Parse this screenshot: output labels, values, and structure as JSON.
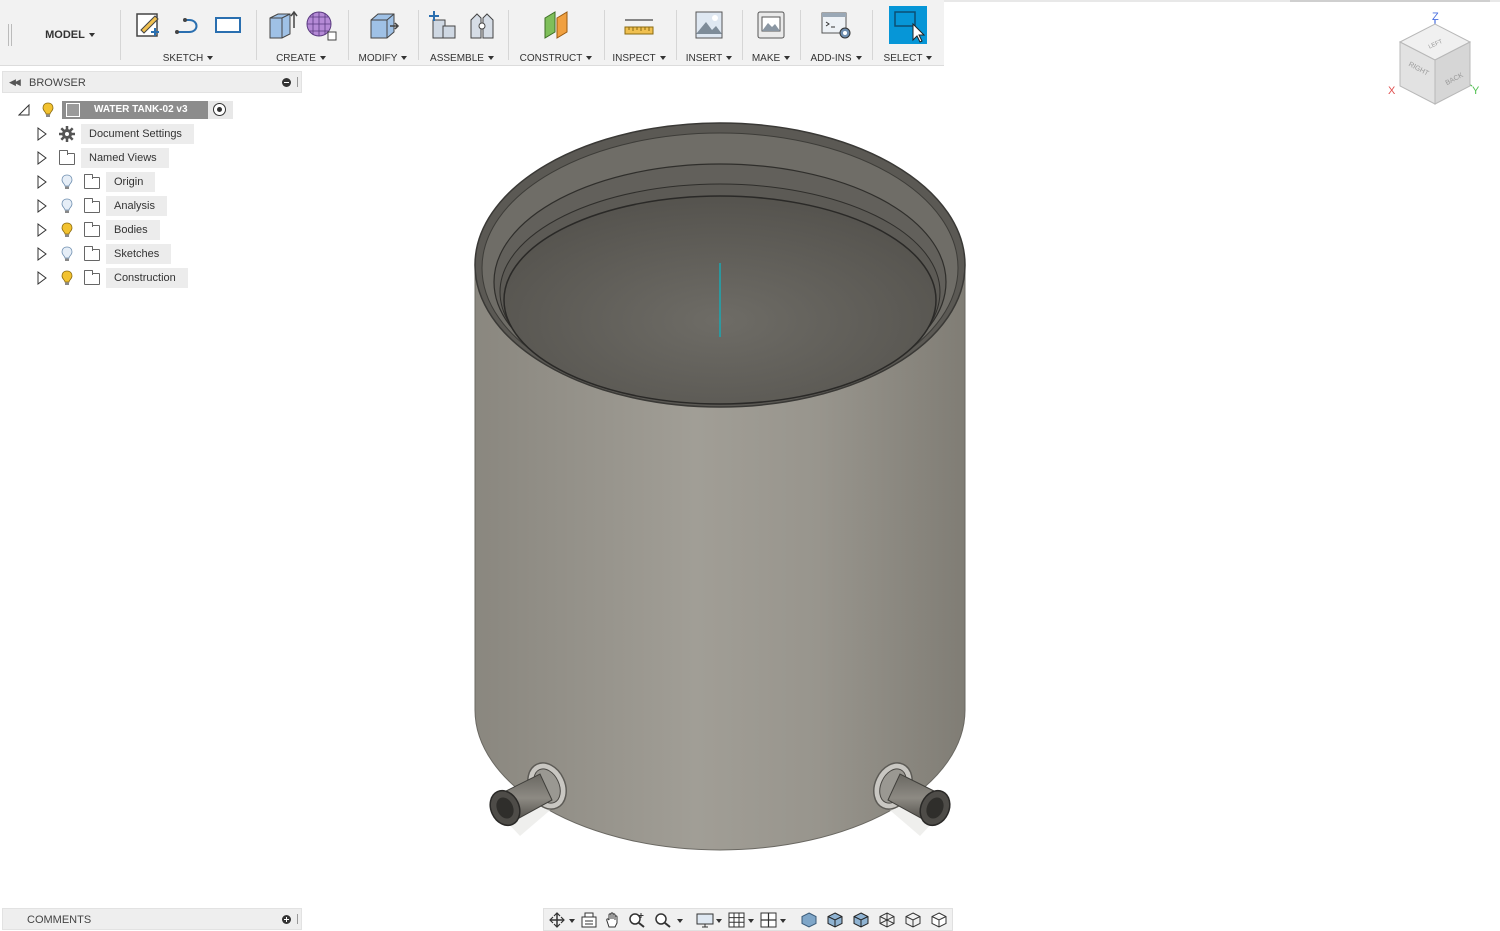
{
  "toolbar": {
    "workspace_label": "MODEL",
    "groups": [
      {
        "label": "SKETCH"
      },
      {
        "label": "CREATE"
      },
      {
        "label": "MODIFY"
      },
      {
        "label": "ASSEMBLE"
      },
      {
        "label": "CONSTRUCT"
      },
      {
        "label": "INSPECT"
      },
      {
        "label": "INSERT"
      },
      {
        "label": "MAKE"
      },
      {
        "label": "ADD-INS"
      },
      {
        "label": "SELECT"
      }
    ]
  },
  "browser": {
    "title": "BROWSER",
    "root": {
      "label": "WATER TANK-02 v3"
    },
    "items": [
      {
        "label": "Document Settings",
        "icon": "gear-icon"
      },
      {
        "label": "Named Views",
        "icon": "folder-icon"
      },
      {
        "label": "Origin",
        "icon": "folder-icon",
        "bulb": "off"
      },
      {
        "label": "Analysis",
        "icon": "folder-icon",
        "bulb": "off"
      },
      {
        "label": "Bodies",
        "icon": "folder-icon",
        "bulb": "on"
      },
      {
        "label": "Sketches",
        "icon": "folder-icon",
        "bulb": "off"
      },
      {
        "label": "Construction",
        "icon": "folder-icon",
        "bulb": "on"
      }
    ]
  },
  "comments": {
    "title": "COMMENTS"
  },
  "viewcube": {
    "axis_x": "X",
    "axis_y": "Y",
    "axis_z": "Z",
    "face_top": "LEFT",
    "face_front": "RIGHT",
    "face_side": "BACK"
  },
  "colors": {
    "select_accent": "#0696d7",
    "bulb_on": "#f2c230",
    "bulb_off": "#a8c4e0",
    "tank_body": "#8f8c85",
    "axis_line": "#1aa8b3"
  }
}
